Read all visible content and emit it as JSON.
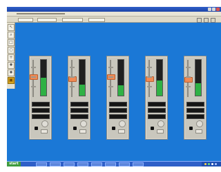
{
  "taskbar": {
    "start_label": "start"
  },
  "icons": {
    "side_tools": [
      "pointer-icon",
      "zoom-icon",
      "square-icon",
      "circle-icon",
      "cross-icon",
      "gear-icon",
      "folder-icon"
    ]
  },
  "channels": [
    {
      "meter_level": 0.5,
      "fader_position": 0.55
    },
    {
      "meter_level": 0.31,
      "fader_position": 0.48
    },
    {
      "meter_level": 0.28,
      "fader_position": 0.56
    },
    {
      "meter_level": 0.42,
      "fader_position": 0.49
    },
    {
      "meter_level": 0.35,
      "fader_position": 0.46
    }
  ]
}
